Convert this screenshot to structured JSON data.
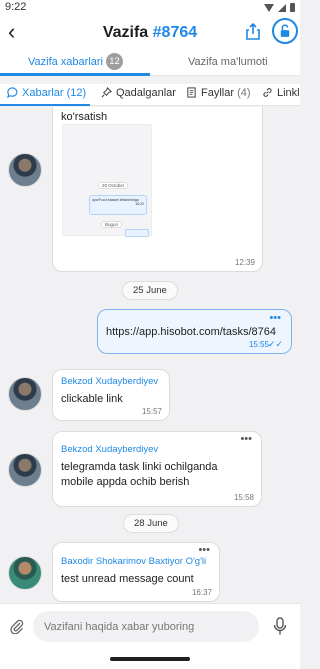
{
  "status_bar": {
    "time": "9:22"
  },
  "header": {
    "back_label": "‹",
    "title_prefix": "Vazifa",
    "title_number": "#8764"
  },
  "top_tabs": [
    {
      "label": "Vazifa xabarlari",
      "badge": "12",
      "active": true
    },
    {
      "label": "Vazifa ma'lumoti",
      "active": false
    }
  ],
  "sub_tabs": [
    {
      "label": "Xabarlar",
      "count": "(12)",
      "icon": "chat-bubble-icon",
      "active": true
    },
    {
      "label": "Qadalganlar",
      "icon": "pin-icon",
      "active": false
    },
    {
      "label": "Fayllar",
      "count": "(4)",
      "icon": "document-icon",
      "active": false
    },
    {
      "label": "Linkl",
      "icon": "link-icon",
      "active": false
    }
  ],
  "messages": {
    "m1": {
      "text": "ko'rsatish",
      "time": "12:39",
      "preview": {
        "date": "20 October",
        "bubble": "ayorFood bazami tekshirishga",
        "time": "16:22",
        "date2": "Bugun"
      }
    },
    "date1": "25 June",
    "m2": {
      "text": "https://app.hisobot.com/tasks/8764",
      "time": "15:55",
      "ticks": "✓✓"
    },
    "m3": {
      "author": "Bekzod Xudayberdiyev",
      "text": "clickable link",
      "time": "15:57"
    },
    "m4": {
      "author": "Bekzod Xudayberdiyev",
      "line1": "telegramda task linki ochilganda",
      "line2": "mobile appda ochib berish",
      "time": "15:58"
    },
    "date2": "28 June",
    "m5": {
      "author": "Baxodir Shokarimov Baxtiyor O'g'li",
      "text": "test unread message count",
      "time": "16:37"
    },
    "menu_dots": "•••"
  },
  "composer": {
    "placeholder": "Vazifani haqida xabar yuboring"
  },
  "colors": {
    "accent": "#1e88e5",
    "outgoing_bg": "#eef5ff",
    "chat_bg": "#f1f1f3"
  }
}
